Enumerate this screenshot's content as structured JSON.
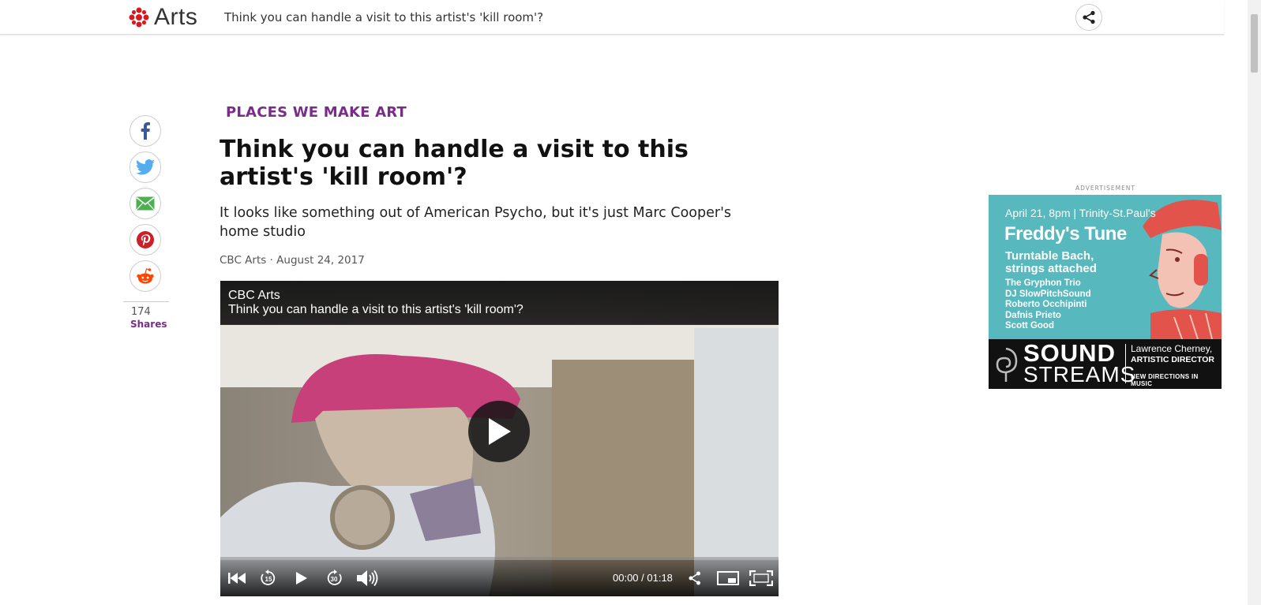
{
  "header": {
    "brand": "Arts",
    "title": "Think you can handle a visit to this artist's 'kill room'?"
  },
  "social": {
    "share_count": "174",
    "share_label": "Shares"
  },
  "article": {
    "category": "PLACES WE MAKE ART",
    "headline": "Think you can handle a visit to this artist's 'kill room'?",
    "deck": "It looks like something out of American Psycho, but it's just Marc Cooper's home studio",
    "byline": "CBC Arts · August 24, 2017"
  },
  "video": {
    "source": "CBC Arts",
    "title": "Think you can handle a visit to this artist's 'kill room'?",
    "time": "00:00 / 01:18",
    "progress": 0
  },
  "ad": {
    "label": "ADVERTISEMENT",
    "date": "April 21, 8pm  |  Trinity-St.Paul's",
    "title": "Freddy's Tune",
    "subtitle": "Turntable Bach, strings attached",
    "performers": [
      "The Gryphon Trio",
      "DJ SlowPitchSound",
      "Roberto Occhipinti",
      "Dafnis Prieto",
      "Scott Good"
    ],
    "brand_line1": "SOUND",
    "brand_line2": "STREAMS",
    "director_name": "Lawrence Cherney,",
    "director_role": "ARTISTIC DIRECTOR",
    "tagline": "NEW DIRECTIONS IN MUSIC"
  },
  "colors": {
    "accent": "#7b2c8a",
    "cbc_red": "#d71920",
    "ad_teal": "#57b8bd"
  }
}
